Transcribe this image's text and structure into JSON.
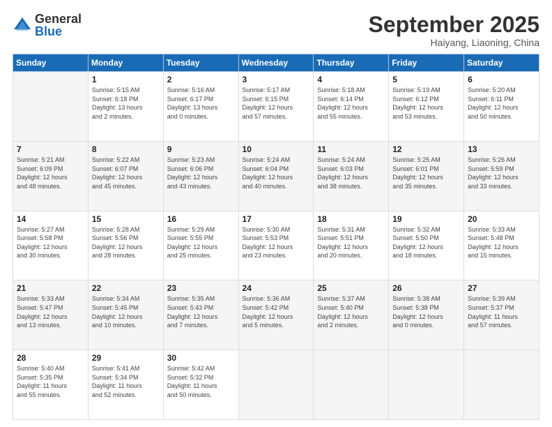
{
  "header": {
    "logo_general": "General",
    "logo_blue": "Blue",
    "month_title": "September 2025",
    "location": "Haiyang, Liaoning, China"
  },
  "weekdays": [
    "Sunday",
    "Monday",
    "Tuesday",
    "Wednesday",
    "Thursday",
    "Friday",
    "Saturday"
  ],
  "weeks": [
    [
      {
        "day": "",
        "info": ""
      },
      {
        "day": "1",
        "info": "Sunrise: 5:15 AM\nSunset: 6:18 PM\nDaylight: 13 hours\nand 2 minutes."
      },
      {
        "day": "2",
        "info": "Sunrise: 5:16 AM\nSunset: 6:17 PM\nDaylight: 13 hours\nand 0 minutes."
      },
      {
        "day": "3",
        "info": "Sunrise: 5:17 AM\nSunset: 6:15 PM\nDaylight: 12 hours\nand 57 minutes."
      },
      {
        "day": "4",
        "info": "Sunrise: 5:18 AM\nSunset: 6:14 PM\nDaylight: 12 hours\nand 55 minutes."
      },
      {
        "day": "5",
        "info": "Sunrise: 5:19 AM\nSunset: 6:12 PM\nDaylight: 12 hours\nand 53 minutes."
      },
      {
        "day": "6",
        "info": "Sunrise: 5:20 AM\nSunset: 6:11 PM\nDaylight: 12 hours\nand 50 minutes."
      }
    ],
    [
      {
        "day": "7",
        "info": "Sunrise: 5:21 AM\nSunset: 6:09 PM\nDaylight: 12 hours\nand 48 minutes."
      },
      {
        "day": "8",
        "info": "Sunrise: 5:22 AM\nSunset: 6:07 PM\nDaylight: 12 hours\nand 45 minutes."
      },
      {
        "day": "9",
        "info": "Sunrise: 5:23 AM\nSunset: 6:06 PM\nDaylight: 12 hours\nand 43 minutes."
      },
      {
        "day": "10",
        "info": "Sunrise: 5:24 AM\nSunset: 6:04 PM\nDaylight: 12 hours\nand 40 minutes."
      },
      {
        "day": "11",
        "info": "Sunrise: 5:24 AM\nSunset: 6:03 PM\nDaylight: 12 hours\nand 38 minutes."
      },
      {
        "day": "12",
        "info": "Sunrise: 5:25 AM\nSunset: 6:01 PM\nDaylight: 12 hours\nand 35 minutes."
      },
      {
        "day": "13",
        "info": "Sunrise: 5:26 AM\nSunset: 5:59 PM\nDaylight: 12 hours\nand 33 minutes."
      }
    ],
    [
      {
        "day": "14",
        "info": "Sunrise: 5:27 AM\nSunset: 5:58 PM\nDaylight: 12 hours\nand 30 minutes."
      },
      {
        "day": "15",
        "info": "Sunrise: 5:28 AM\nSunset: 5:56 PM\nDaylight: 12 hours\nand 28 minutes."
      },
      {
        "day": "16",
        "info": "Sunrise: 5:29 AM\nSunset: 5:55 PM\nDaylight: 12 hours\nand 25 minutes."
      },
      {
        "day": "17",
        "info": "Sunrise: 5:30 AM\nSunset: 5:53 PM\nDaylight: 12 hours\nand 23 minutes."
      },
      {
        "day": "18",
        "info": "Sunrise: 5:31 AM\nSunset: 5:51 PM\nDaylight: 12 hours\nand 20 minutes."
      },
      {
        "day": "19",
        "info": "Sunrise: 5:32 AM\nSunset: 5:50 PM\nDaylight: 12 hours\nand 18 minutes."
      },
      {
        "day": "20",
        "info": "Sunrise: 5:33 AM\nSunset: 5:48 PM\nDaylight: 12 hours\nand 15 minutes."
      }
    ],
    [
      {
        "day": "21",
        "info": "Sunrise: 5:33 AM\nSunset: 5:47 PM\nDaylight: 12 hours\nand 13 minutes."
      },
      {
        "day": "22",
        "info": "Sunrise: 5:34 AM\nSunset: 5:45 PM\nDaylight: 12 hours\nand 10 minutes."
      },
      {
        "day": "23",
        "info": "Sunrise: 5:35 AM\nSunset: 5:43 PM\nDaylight: 12 hours\nand 7 minutes."
      },
      {
        "day": "24",
        "info": "Sunrise: 5:36 AM\nSunset: 5:42 PM\nDaylight: 12 hours\nand 5 minutes."
      },
      {
        "day": "25",
        "info": "Sunrise: 5:37 AM\nSunset: 5:40 PM\nDaylight: 12 hours\nand 2 minutes."
      },
      {
        "day": "26",
        "info": "Sunrise: 5:38 AM\nSunset: 5:38 PM\nDaylight: 12 hours\nand 0 minutes."
      },
      {
        "day": "27",
        "info": "Sunrise: 5:39 AM\nSunset: 5:37 PM\nDaylight: 11 hours\nand 57 minutes."
      }
    ],
    [
      {
        "day": "28",
        "info": "Sunrise: 5:40 AM\nSunset: 5:35 PM\nDaylight: 11 hours\nand 55 minutes."
      },
      {
        "day": "29",
        "info": "Sunrise: 5:41 AM\nSunset: 5:34 PM\nDaylight: 11 hours\nand 52 minutes."
      },
      {
        "day": "30",
        "info": "Sunrise: 5:42 AM\nSunset: 5:32 PM\nDaylight: 11 hours\nand 50 minutes."
      },
      {
        "day": "",
        "info": ""
      },
      {
        "day": "",
        "info": ""
      },
      {
        "day": "",
        "info": ""
      },
      {
        "day": "",
        "info": ""
      }
    ]
  ]
}
